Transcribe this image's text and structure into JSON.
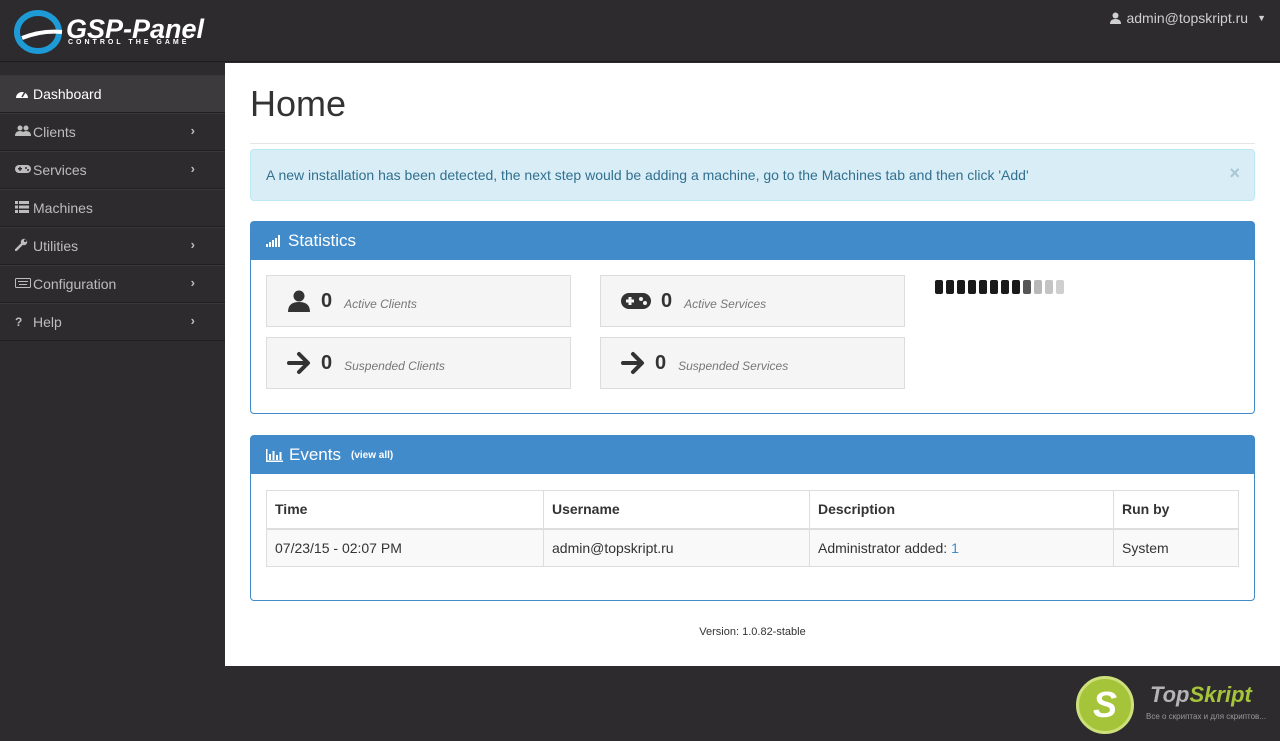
{
  "brand": {
    "name": "GSP-Panel",
    "tagline": "CONTROL THE GAME"
  },
  "user": {
    "email": "admin@topskript.ru"
  },
  "sidebar": {
    "items": [
      {
        "label": "Dashboard",
        "icon": "dashboard-icon",
        "active": true,
        "has_submenu": false
      },
      {
        "label": "Clients",
        "icon": "users-icon",
        "active": false,
        "has_submenu": true
      },
      {
        "label": "Services",
        "icon": "gamepad-icon",
        "active": false,
        "has_submenu": true
      },
      {
        "label": "Machines",
        "icon": "list-icon",
        "active": false,
        "has_submenu": false
      },
      {
        "label": "Utilities",
        "icon": "wrench-icon",
        "active": false,
        "has_submenu": true
      },
      {
        "label": "Configuration",
        "icon": "keyboard-icon",
        "active": false,
        "has_submenu": true
      },
      {
        "label": "Help",
        "icon": "question-icon",
        "active": false,
        "has_submenu": true
      }
    ]
  },
  "main": {
    "title": "Home",
    "alert": "A new installation has been detected, the next step would be adding a machine, go to the Machines tab and then click 'Add'",
    "statistics": {
      "title": "Statistics",
      "boxes": [
        {
          "value": "0",
          "label": "Active Clients",
          "icon": "user-icon"
        },
        {
          "value": "0",
          "label": "Active Services",
          "icon": "gamepad-icon"
        },
        {
          "value": "0",
          "label": "Suspended Clients",
          "icon": "arrow-right-icon"
        },
        {
          "value": "0",
          "label": "Suspended Services",
          "icon": "arrow-right-icon"
        }
      ]
    },
    "events": {
      "title": "Events",
      "view_all": "(view all)",
      "columns": [
        "Time",
        "Username",
        "Description",
        "Run by"
      ],
      "rows": [
        {
          "time": "07/23/15 - 02:07 PM",
          "username": "admin@topskript.ru",
          "description": "Administrator added: ",
          "link": "1",
          "run_by": "System"
        }
      ]
    },
    "version": "Version: 1.0.82-stable"
  },
  "watermark": {
    "name_a": "Top",
    "name_b": "Skript",
    "sub": "Все о скриптах и для скриптов...",
    "badge": "S"
  },
  "colors": {
    "primary": "#428bca",
    "sidebar_bg": "#2d2b2e",
    "alert_bg": "#d9edf7",
    "alert_text": "#31708f"
  }
}
